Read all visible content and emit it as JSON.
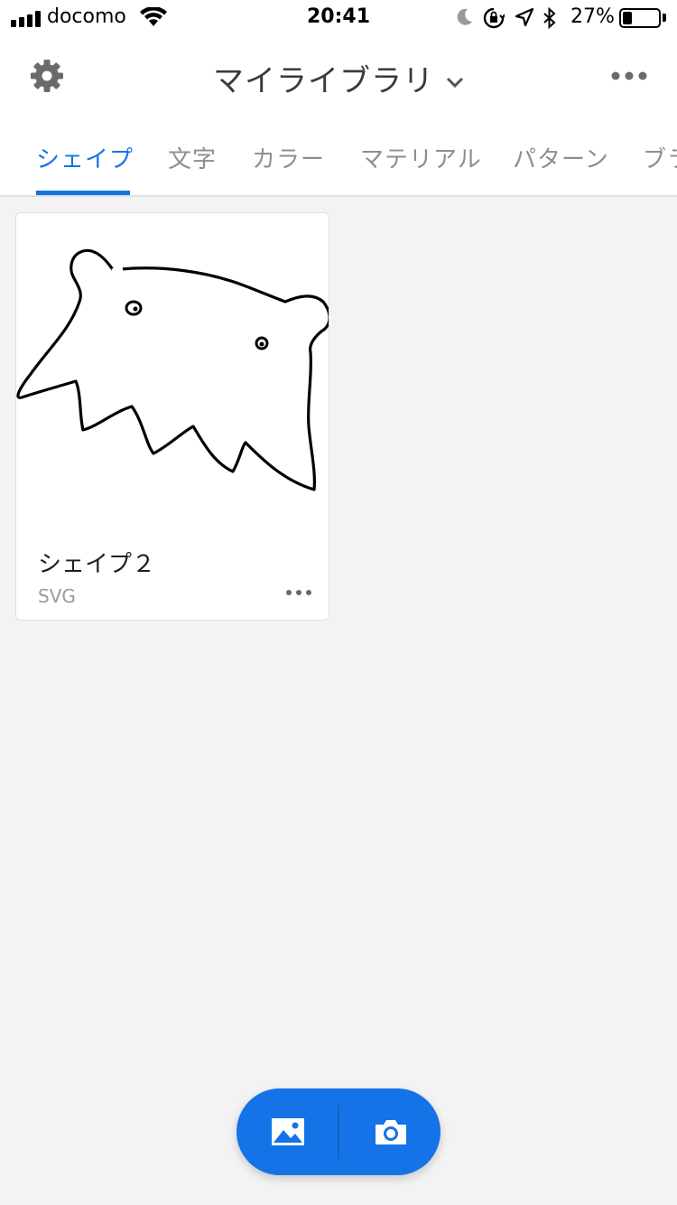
{
  "status_bar": {
    "carrier": "docomo",
    "time": "20:41",
    "battery_percent": "27%",
    "battery_level": 0.27
  },
  "header": {
    "title": "マイライブラリ"
  },
  "tabs": [
    {
      "label": "シェイプ",
      "active": true
    },
    {
      "label": "文字",
      "active": false
    },
    {
      "label": "カラー",
      "active": false
    },
    {
      "label": "マテリアル",
      "active": false
    },
    {
      "label": "パターン",
      "active": false
    },
    {
      "label": "ブラシ",
      "active": false
    }
  ],
  "assets": [
    {
      "name": "シェイプ２",
      "type": "SVG"
    }
  ],
  "colors": {
    "accent": "#1473e6",
    "background": "#f3f3f3",
    "tab_inactive": "#8e8e8e"
  }
}
